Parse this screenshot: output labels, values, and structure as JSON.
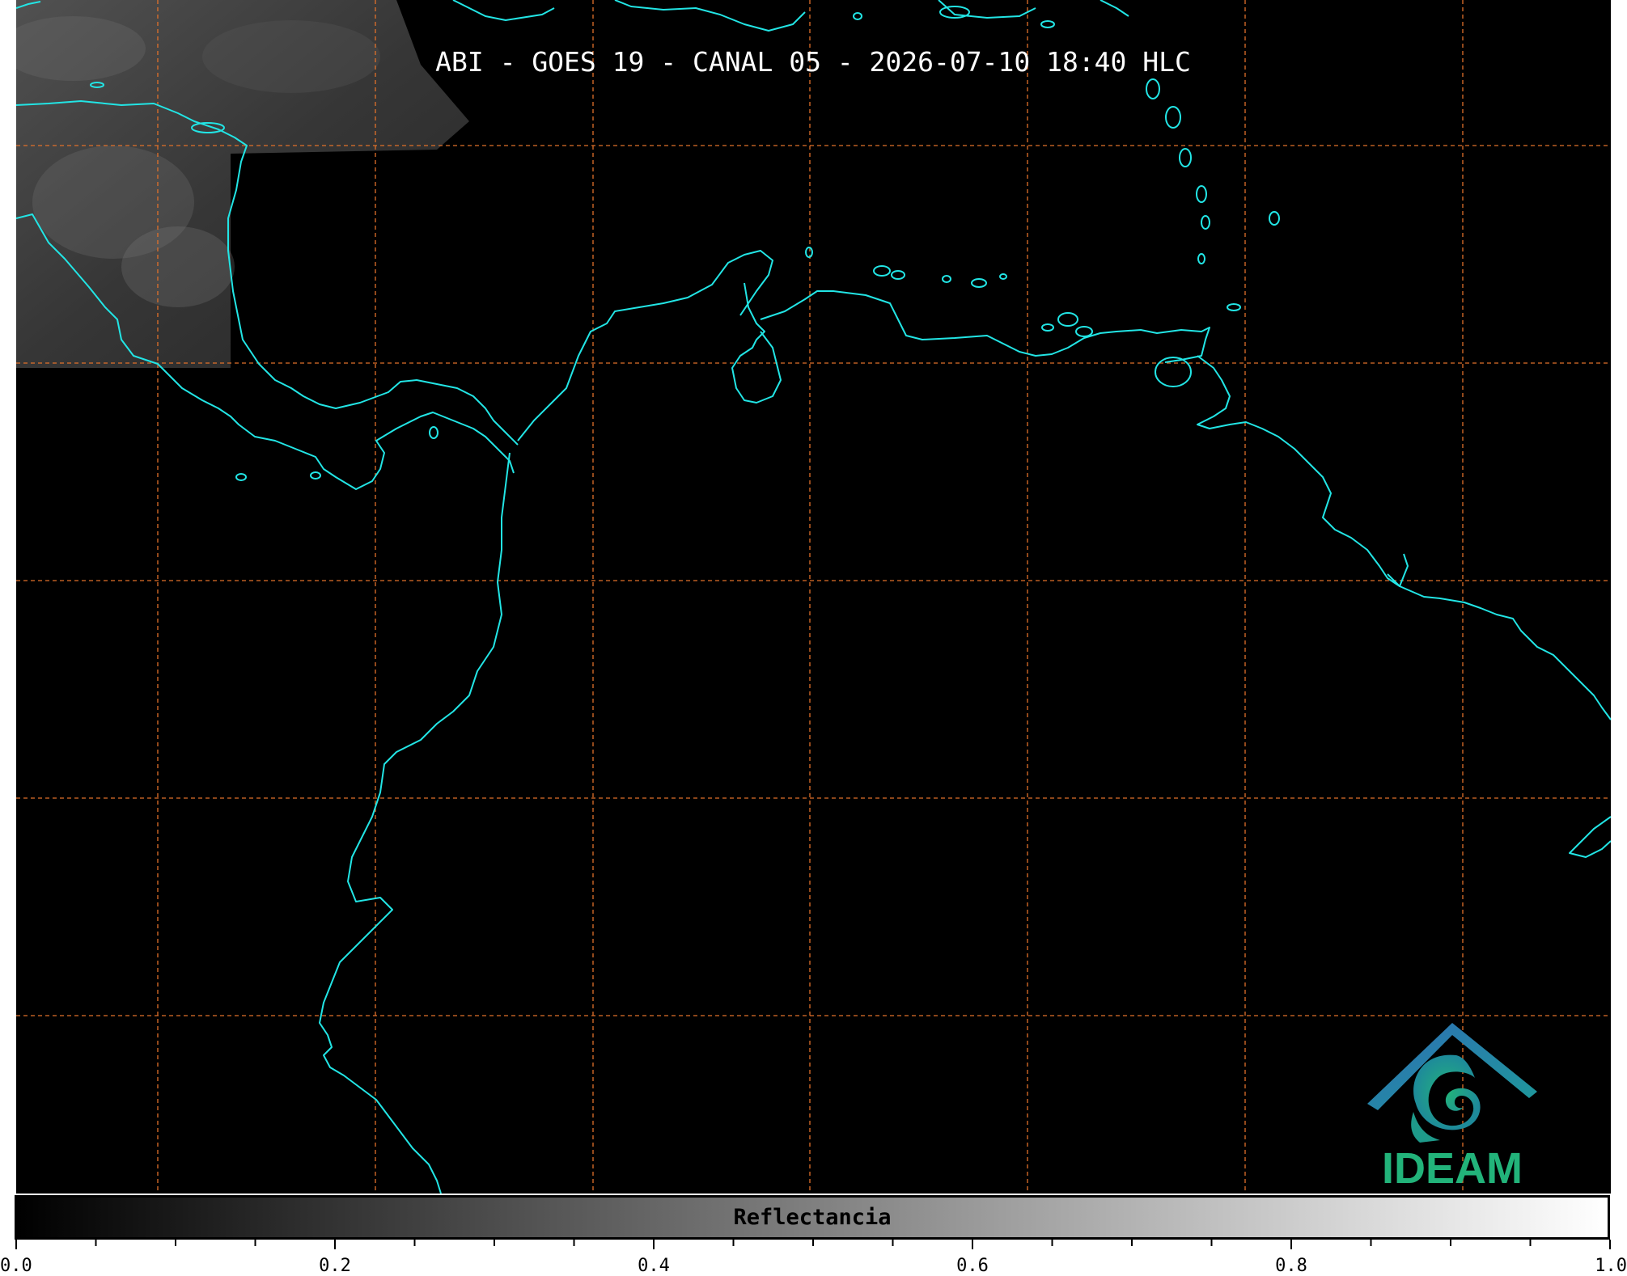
{
  "title": "ABI - GOES 19 - CANAL 05 - 2026-07-10 18:40 HLC",
  "colorbar": {
    "label": "Reflectancia",
    "min": 0.0,
    "max": 1.0,
    "major_ticks": [
      "0.0",
      "0.2",
      "0.4",
      "0.6",
      "0.8",
      "1.0"
    ],
    "minor_tick_step": 0.05
  },
  "logo": {
    "text": "IDEAM"
  },
  "colors": {
    "background": "#000000",
    "coastline": "#22e5e5",
    "gridlines": "#e0702a",
    "logo_teal": "#1e9a9a",
    "logo_green": "#22b37a",
    "logo_blue": "#2e6eb5"
  },
  "map": {
    "gridlines": true,
    "gridline_style": "dashed"
  }
}
